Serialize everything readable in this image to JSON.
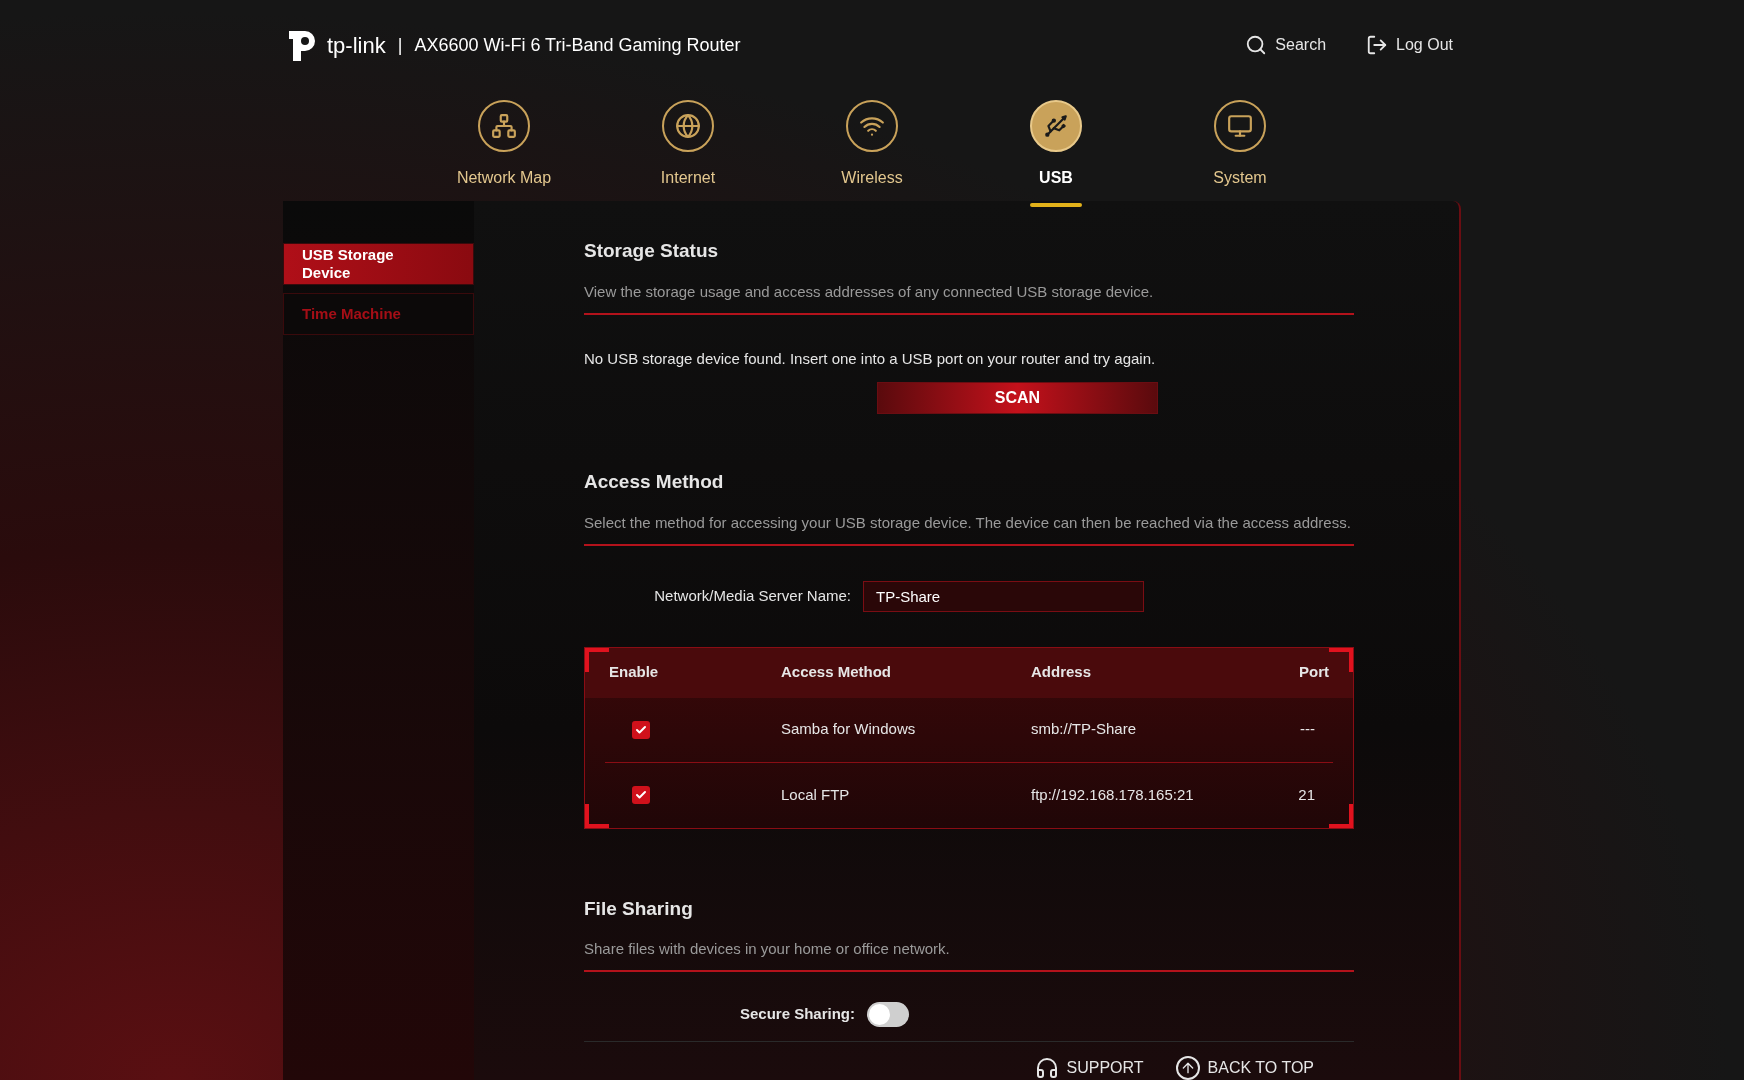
{
  "header": {
    "logo_text": "tp-link",
    "separator": "|",
    "product": "AX6600 Wi-Fi 6 Tri-Band Gaming Router",
    "actions": [
      {
        "kind": "search",
        "label": "Search"
      },
      {
        "kind": "logout",
        "label": "Log Out"
      }
    ]
  },
  "nav": [
    {
      "kind": "network",
      "label": "Network Map",
      "selected": false
    },
    {
      "kind": "internet",
      "label": "Internet",
      "selected": false
    },
    {
      "kind": "wireless",
      "label": "Wireless",
      "selected": false
    },
    {
      "kind": "usb",
      "label": "USB",
      "selected": true
    },
    {
      "kind": "system",
      "label": "System",
      "selected": false
    }
  ],
  "sidebar": {
    "items": [
      {
        "label": "USB Storage Device",
        "selected": true
      },
      {
        "label": "Time Machine",
        "selected": false
      }
    ]
  },
  "storage_status": {
    "title": "Storage Status",
    "description": "View the storage usage and access addresses of any connected USB storage device.",
    "message": "No USB storage device found. Insert one into a USB port on your router and try again.",
    "button": "SCAN"
  },
  "access_method": {
    "title": "Access Method",
    "description": "Select the method for accessing your USB storage device. The device can then be reached via the access address.",
    "server_name": {
      "label": "Network/Media Server Name:",
      "value": "TP-Share"
    },
    "table": {
      "columns": [
        "Enable",
        "Access Method",
        "Address",
        "Port"
      ],
      "rows": [
        {
          "checked": true,
          "method": "Samba for Windows",
          "address": "smb://TP-Share",
          "port": "---"
        },
        {
          "checked": true,
          "method": "Local FTP",
          "address": "ftp://192.168.178.165:21",
          "port": "21"
        }
      ]
    }
  },
  "file_sharing": {
    "title": "File Sharing",
    "description": "Share files with devices in your home or office network.",
    "secure_sharing": {
      "label": "Secure Sharing:",
      "on": false
    }
  },
  "footer": [
    {
      "kind": "support",
      "label": "SUPPORT"
    },
    {
      "kind": "top",
      "label": "BACK TO TOP"
    }
  ]
}
